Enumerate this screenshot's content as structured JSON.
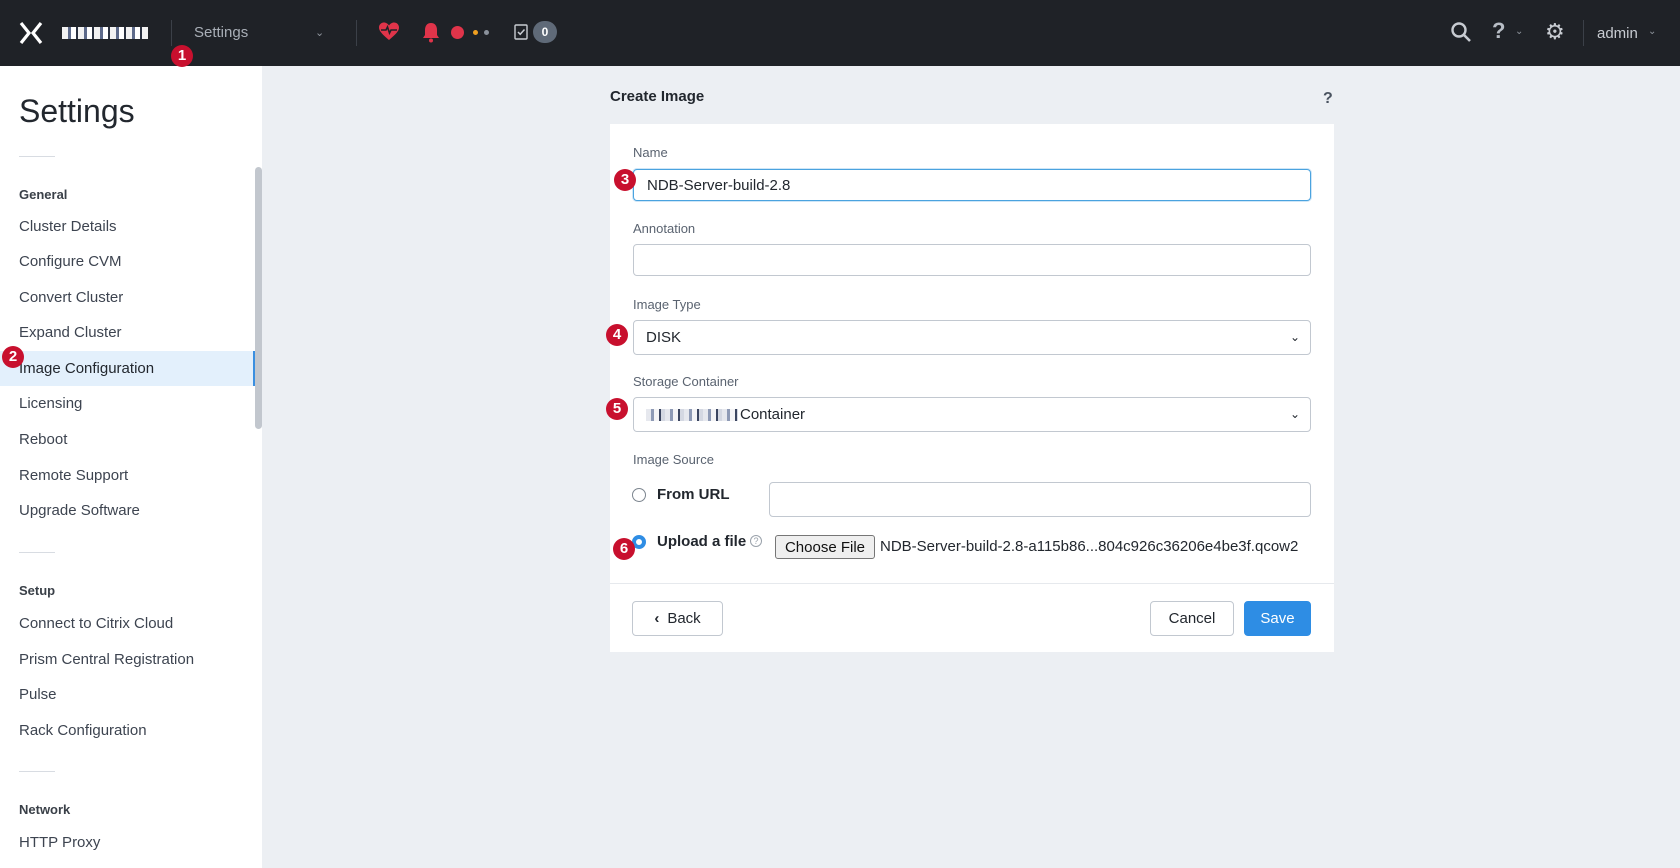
{
  "topbar": {
    "app_name": "Settings",
    "task_count": "0",
    "user": "admin",
    "help_glyph": "?",
    "icons": [
      "nutanix-x-logo",
      "chevron-down-icon",
      "health-heart-icon",
      "alert-bell-icon",
      "task-checklist-icon",
      "search-icon",
      "help-icon",
      "gear-icon"
    ]
  },
  "markers": [
    "1",
    "2",
    "3",
    "4",
    "5",
    "6"
  ],
  "sidebar": {
    "title": "Settings",
    "sections": [
      {
        "label": "General",
        "items": [
          "Cluster Details",
          "Configure CVM",
          "Convert Cluster",
          "Expand Cluster",
          "Image Configuration",
          "Licensing",
          "Reboot",
          "Remote Support",
          "Upgrade Software"
        ]
      },
      {
        "label": "Setup",
        "items": [
          "Connect to Citrix Cloud",
          "Prism Central Registration",
          "Pulse",
          "Rack Configuration"
        ]
      },
      {
        "label": "Network",
        "items": [
          "HTTP Proxy"
        ]
      }
    ],
    "active_item": "Image Configuration"
  },
  "form": {
    "title": "Create Image",
    "help": "?",
    "name_label": "Name",
    "name_value": "NDB-Server-build-2.8",
    "annotation_label": "Annotation",
    "annotation_value": "",
    "image_type_label": "Image Type",
    "image_type_value": "DISK",
    "storage_label": "Storage Container",
    "storage_value": "Container",
    "image_source_label": "Image Source",
    "from_url_label": "From URL",
    "from_url_value": "",
    "upload_label": "Upload a file",
    "info_glyph": "?",
    "choose_file_label": "Choose File",
    "file_name": "NDB-Server-build-2.8-a115b86...804c926c36206e4be3f.qcow2",
    "selected_source": "Upload a file"
  },
  "actions": {
    "back": "Back",
    "cancel": "Cancel",
    "save": "Save"
  },
  "colors": {
    "topbar": "#1f2227",
    "accent": "#2e8de4",
    "marker": "#c8102e",
    "active_item_bg": "#e3f0fc"
  }
}
